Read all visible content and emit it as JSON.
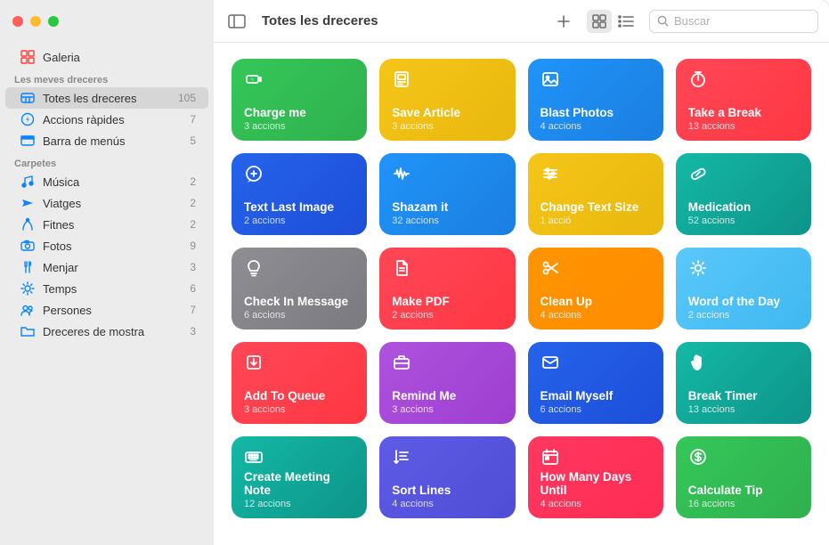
{
  "header": {
    "title": "Totes les dreceres",
    "search_placeholder": "Buscar"
  },
  "sidebar": {
    "gallery_label": "Galeria",
    "section1_header": "Les meves dreceres",
    "section2_header": "Carpetes",
    "main_items": [
      {
        "label": "Totes les dreceres",
        "count": "105",
        "icon": "grid"
      },
      {
        "label": "Accions ràpides",
        "count": "7",
        "icon": "bolt"
      },
      {
        "label": "Barra de menús",
        "count": "5",
        "icon": "menubar"
      }
    ],
    "folders": [
      {
        "label": "Música",
        "count": "2",
        "icon": "music"
      },
      {
        "label": "Viatges",
        "count": "2",
        "icon": "plane"
      },
      {
        "label": "Fitnes",
        "count": "2",
        "icon": "fitness"
      },
      {
        "label": "Fotos",
        "count": "9",
        "icon": "camera"
      },
      {
        "label": "Menjar",
        "count": "3",
        "icon": "fork"
      },
      {
        "label": "Temps",
        "count": "6",
        "icon": "sun"
      },
      {
        "label": "Persones",
        "count": "7",
        "icon": "people"
      },
      {
        "label": "Dreceres de mostra",
        "count": "3",
        "icon": "folder"
      }
    ]
  },
  "shortcuts": [
    {
      "title": "Charge me",
      "sub": "3 accions",
      "color": "g-green",
      "icon": "battery"
    },
    {
      "title": "Save Article",
      "sub": "3 accions",
      "color": "g-yellow",
      "icon": "article"
    },
    {
      "title": "Blast Photos",
      "sub": "4 accions",
      "color": "g-blue",
      "icon": "photo"
    },
    {
      "title": "Take a Break",
      "sub": "13 accions",
      "color": "g-red",
      "icon": "timer"
    },
    {
      "title": "Text Last Image",
      "sub": "2 accions",
      "color": "g-darkblue",
      "icon": "message"
    },
    {
      "title": "Shazam it",
      "sub": "32 accions",
      "color": "g-blue",
      "icon": "wave"
    },
    {
      "title": "Change Text Size",
      "sub": "1 acció",
      "color": "g-yellow",
      "icon": "sliders"
    },
    {
      "title": "Medication",
      "sub": "52 accions",
      "color": "g-teal",
      "icon": "pill"
    },
    {
      "title": "Check In Message",
      "sub": "6 accions",
      "color": "g-gray",
      "icon": "bulb"
    },
    {
      "title": "Make PDF",
      "sub": "2 accions",
      "color": "g-red",
      "icon": "doc"
    },
    {
      "title": "Clean Up",
      "sub": "4 accions",
      "color": "g-orange",
      "icon": "scissors"
    },
    {
      "title": "Word of the Day",
      "sub": "2 accions",
      "color": "g-cyan",
      "icon": "sunrise"
    },
    {
      "title": "Add To Queue",
      "sub": "3 accions",
      "color": "g-red",
      "icon": "download"
    },
    {
      "title": "Remind Me",
      "sub": "3 accions",
      "color": "g-purple",
      "icon": "briefcase"
    },
    {
      "title": "Email Myself",
      "sub": "6 accions",
      "color": "g-darkblue",
      "icon": "mail"
    },
    {
      "title": "Break Timer",
      "sub": "13 accions",
      "color": "g-teal",
      "icon": "hand"
    },
    {
      "title": "Create Meeting Note",
      "sub": "12 accions",
      "color": "g-teal",
      "icon": "keyboard"
    },
    {
      "title": "Sort Lines",
      "sub": "4 accions",
      "color": "g-indigo",
      "icon": "lines"
    },
    {
      "title": "How Many Days Until",
      "sub": "4 accions",
      "color": "g-pink",
      "icon": "calendar"
    },
    {
      "title": "Calculate Tip",
      "sub": "16 accions",
      "color": "g-green",
      "icon": "dollar"
    }
  ]
}
